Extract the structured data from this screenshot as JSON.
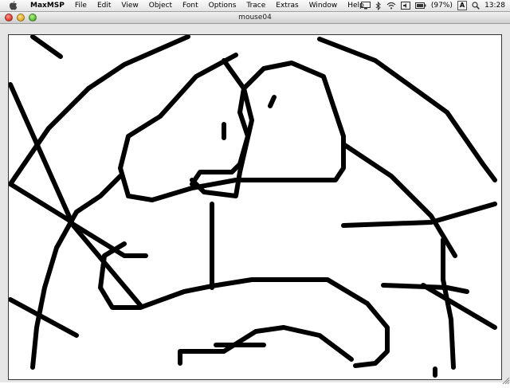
{
  "menubar": {
    "apple_icon": "apple-logo",
    "app_name": "MaxMSP",
    "items": [
      {
        "label": "File"
      },
      {
        "label": "Edit"
      },
      {
        "label": "View"
      },
      {
        "label": "Object"
      },
      {
        "label": "Font"
      },
      {
        "label": "Options"
      },
      {
        "label": "Trace"
      },
      {
        "label": "Extras"
      },
      {
        "label": "Window"
      },
      {
        "label": "Help"
      }
    ],
    "status": {
      "battery_text": "(97%)",
      "input_menu": "A",
      "clock": "13:28"
    }
  },
  "window": {
    "title": "mouse04",
    "controls": [
      "close",
      "minimize",
      "zoom"
    ]
  },
  "canvas": {
    "background": "#ffffff",
    "stroke_color": "#000000"
  }
}
